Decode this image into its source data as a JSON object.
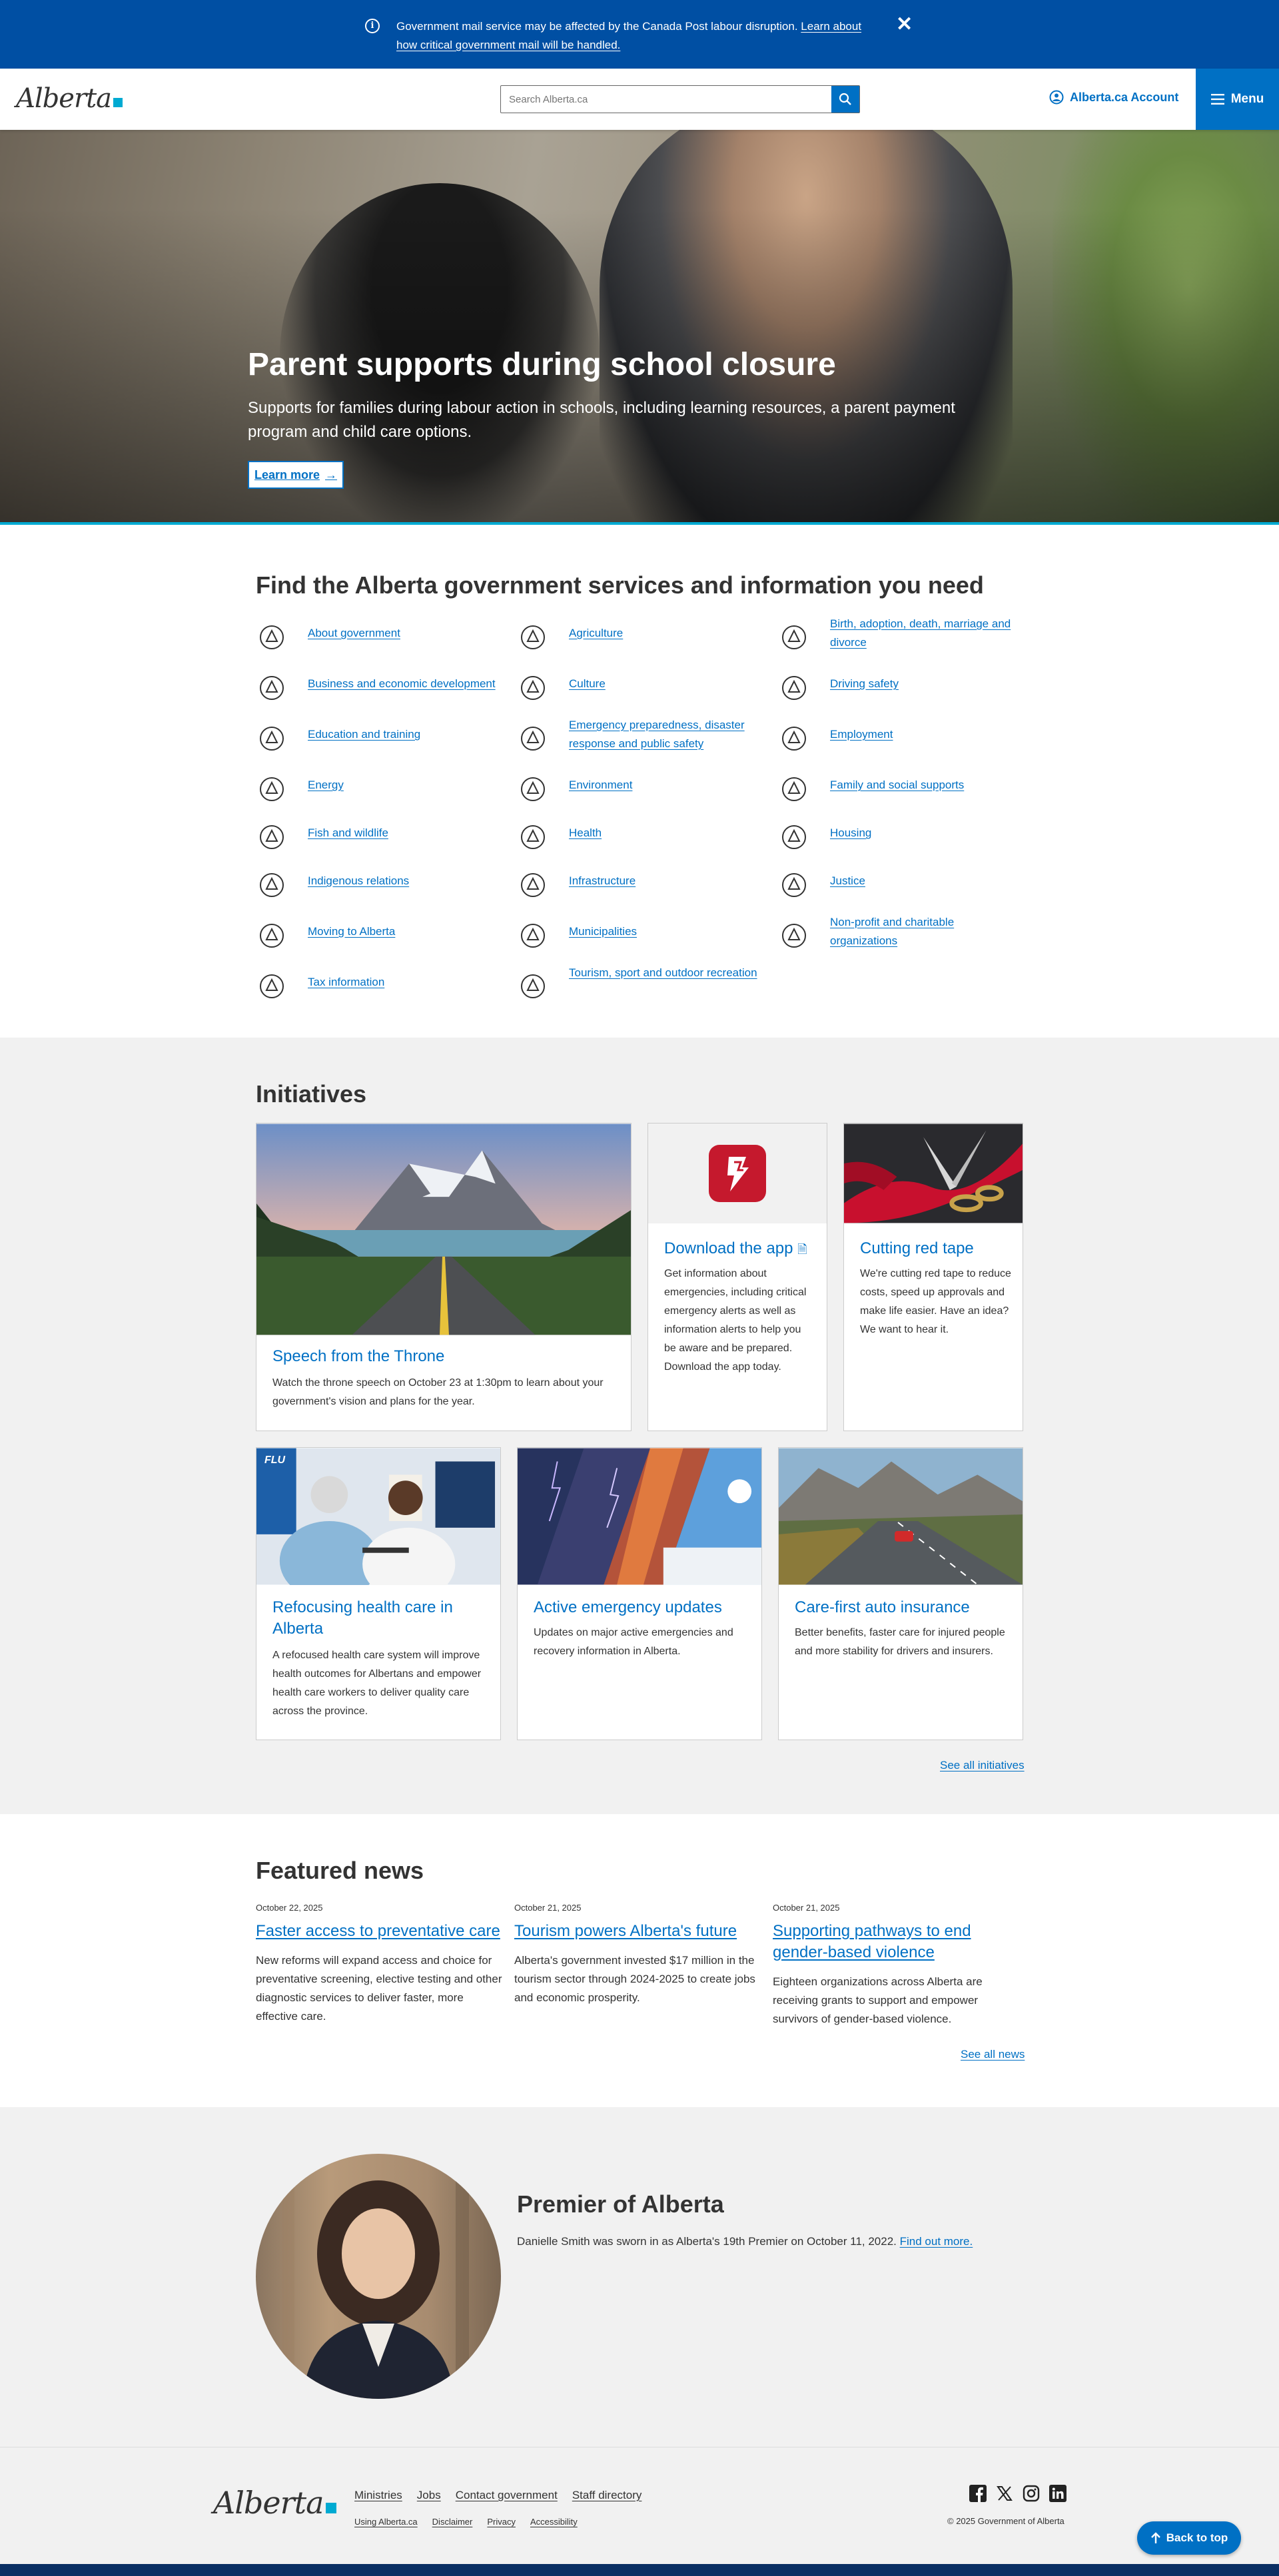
{
  "notification": {
    "message": "Government mail service may be affected by the Canada Post labour disruption.",
    "link": "Learn about how critical government mail will be handled.",
    "close": "✕"
  },
  "header": {
    "logo": "Alberta",
    "search_placeholder": "Search Alberta.ca",
    "account": "Alberta.ca Account",
    "menu": "Menu"
  },
  "hero": {
    "title": "Parent supports during school closure",
    "text": "Supports for families during labour action in schools, including learning resources, a parent payment program and child care options.",
    "button": "Learn more"
  },
  "services": {
    "title": "Find the Alberta government services and information you need",
    "items": [
      {
        "label": "About government",
        "icon": "government-building-icon"
      },
      {
        "label": "Agriculture",
        "icon": "sun-field-icon"
      },
      {
        "label": "Birth, adoption, death, marriage and divorce",
        "icon": "certificate-icon"
      },
      {
        "label": "Business and economic development",
        "icon": "pie-chart-icon"
      },
      {
        "label": "Culture",
        "icon": "masks-icon"
      },
      {
        "label": "Driving safety",
        "icon": "traffic-light-icon"
      },
      {
        "label": "Education and training",
        "icon": "graduation-cap-icon"
      },
      {
        "label": "Emergency preparedness, disaster response and public safety",
        "icon": "warning-triangle-icon"
      },
      {
        "label": "Employment",
        "icon": "worker-icon"
      },
      {
        "label": "Energy",
        "icon": "energy-icon"
      },
      {
        "label": "Environment",
        "icon": "plant-icon"
      },
      {
        "label": "Family and social supports",
        "icon": "family-icon"
      },
      {
        "label": "Fish and wildlife",
        "icon": "wildlife-icon"
      },
      {
        "label": "Health",
        "icon": "heart-pulse-icon"
      },
      {
        "label": "Housing",
        "icon": "house-icon"
      },
      {
        "label": "Indigenous relations",
        "icon": "medicine-wheel-icon"
      },
      {
        "label": "Infrastructure",
        "icon": "bridge-icon"
      },
      {
        "label": "Justice",
        "icon": "scales-icon"
      },
      {
        "label": "Moving to Alberta",
        "icon": "alberta-map-icon"
      },
      {
        "label": "Municipalities",
        "icon": "location-pin-icon"
      },
      {
        "label": "Non-profit and charitable organizations",
        "icon": "handshake-icon"
      },
      {
        "label": "Tax information",
        "icon": "tax-person-icon"
      },
      {
        "label": "Tourism, sport and outdoor recreation",
        "icon": "tourism-icon"
      }
    ]
  },
  "initiatives": {
    "title": "Initiatives",
    "cards": [
      {
        "title": "Speech from the Throne",
        "text": "Watch the throne speech on October 23 at 1:30pm to learn about your government's vision and plans for the year."
      },
      {
        "title": "Download the app",
        "text": "Get information about emergencies, including critical emergency alerts as well as information alerts to help you be aware and be prepared. Download the app today."
      },
      {
        "title": "Cutting red tape",
        "text": "We're cutting red tape to reduce costs, speed up approvals and make life easier. Have an idea? We want to hear it."
      },
      {
        "title": "Refocusing health care in Alberta",
        "text": "A refocused health care system will improve health outcomes for Albertans and empower health care workers to deliver quality care across the province."
      },
      {
        "title": "Active emergency updates",
        "text": "Updates on major active emergencies and recovery information in Alberta."
      },
      {
        "title": "Care-first auto insurance",
        "text": "Better benefits, faster care for injured people and more stability for drivers and insurers."
      }
    ],
    "see_all": "See all initiatives",
    "flu_badge": "FLU"
  },
  "news": {
    "title": "Featured news",
    "items": [
      {
        "date": "October 22, 2025",
        "title": "Faster access to preventative care",
        "text": "New reforms will expand access and choice for preventative screening, elective testing and other diagnostic services to deliver faster, more effective care."
      },
      {
        "date": "October 21, 2025",
        "title": "Tourism powers Alberta's future",
        "text": "Alberta's government invested $17 million in the tourism sector through 2024-2025 to create jobs and economic prosperity."
      },
      {
        "date": "October 21, 2025",
        "title": "Supporting pathways to end gender-based violence",
        "text": "Eighteen organizations across Alberta are receiving grants to support and empower survivors of gender-based violence."
      }
    ],
    "see_all": "See all news"
  },
  "premier": {
    "title": "Premier of Alberta",
    "text": "Danielle Smith was sworn in as Alberta's 19th Premier on October 11, 2022.",
    "link": "Find out more."
  },
  "footer": {
    "logo": "Alberta",
    "links": [
      "Ministries",
      "Jobs",
      "Contact government",
      "Staff directory"
    ],
    "sublinks": [
      "Using Alberta.ca",
      "Disclaimer",
      "Privacy",
      "Accessibility"
    ],
    "copyright": "© 2025 Government of Alberta",
    "social": [
      "facebook-icon",
      "x-icon",
      "instagram-icon",
      "linkedin-icon"
    ],
    "back_to_top": "Back to top"
  },
  "colors": {
    "primary": "#0070c4",
    "notice": "#004fa3",
    "accent": "#00aad2",
    "section_bg": "#f1f1f1"
  }
}
